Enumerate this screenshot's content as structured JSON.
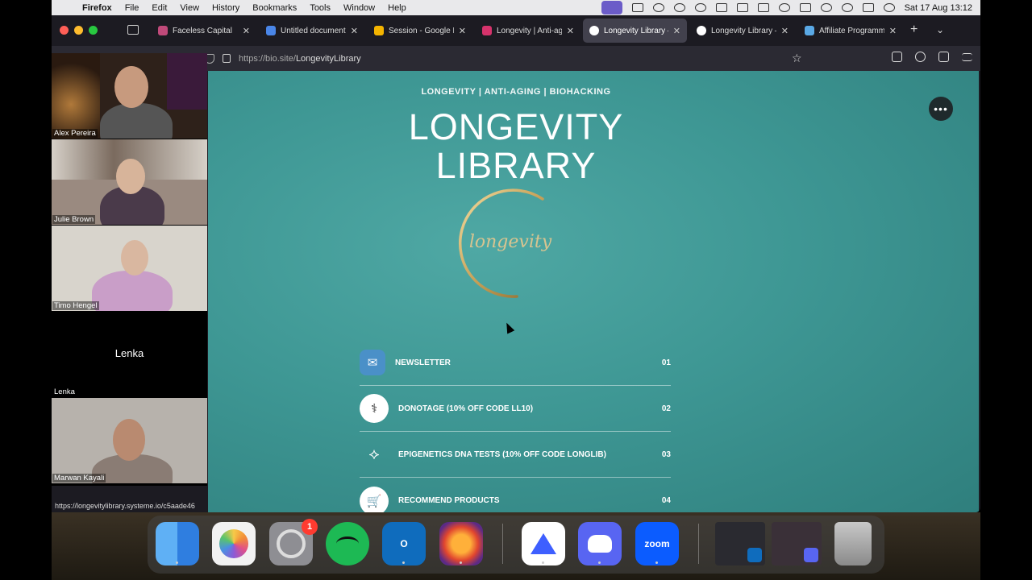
{
  "menubar": {
    "app": "Firefox",
    "items": [
      "File",
      "Edit",
      "View",
      "History",
      "Bookmarks",
      "Tools",
      "Window",
      "Help"
    ],
    "clock": "Sat 17 Aug  13:12"
  },
  "browser": {
    "tabs": [
      {
        "title": "Faceless Capital",
        "favicon_color": "#c04a7a"
      },
      {
        "title": "Untitled document -",
        "favicon_color": "#4a86e8"
      },
      {
        "title": "Session - Google Dr",
        "favicon_color": "#f4b400"
      },
      {
        "title": "Longevity | Anti-aging",
        "favicon_color": "#d6336c"
      },
      {
        "title": "Longevity Library —",
        "favicon_color": "#ffffff"
      },
      {
        "title": "Longevity Library —",
        "favicon_color": "#ffffff"
      },
      {
        "title": "Affiliate Programme",
        "favicon_color": "#5aa9e6"
      }
    ],
    "url_prefix": "https://bio.site/",
    "url_path": "LongevityLibrary",
    "status_url": "https://longevitylibrary.systeme.io/c5aade46"
  },
  "gallery": [
    {
      "name": "Alex Pereira",
      "bg": "#3a2a22"
    },
    {
      "name": "Julie Brown",
      "bg": "#9a8a80"
    },
    {
      "name": "Timo Hengel",
      "bg": "#d8d4cc"
    },
    {
      "name": "Lenka",
      "bg": "#000000",
      "center_label": "Lenka"
    },
    {
      "name": "Marwan Kayali",
      "bg": "#b7b2ac"
    }
  ],
  "page": {
    "eyebrow": "LONGEVITY | ANTI-AGING | BIOHACKING",
    "headline_line1": "LONGEVITY",
    "headline_line2": "LIBRARY",
    "logo_text": "longevity",
    "more_label": "•••",
    "links": [
      {
        "label": "NEWSLETTER",
        "num": "01",
        "icon": "newsletter-icon"
      },
      {
        "label": "DONOTAGE (10% OFF CODE LL10)",
        "num": "02",
        "icon": "dna-icon"
      },
      {
        "label": "EPIGENETICS DNA TESTS (10% OFF CODE LONGLIB)",
        "num": "03",
        "icon": "dna-strand-icon"
      },
      {
        "label": "RECOMMEND PRODUCTS",
        "num": "04",
        "icon": "cart-icon"
      }
    ]
  },
  "dock": {
    "items": [
      {
        "name": "Finder",
        "color": "#3c8ce7"
      },
      {
        "name": "Photos",
        "color": "#f2f2f2"
      },
      {
        "name": "System Settings",
        "color": "#8e8e93",
        "badge": "1"
      },
      {
        "name": "Spotify",
        "color": "#1db954"
      },
      {
        "name": "Outlook",
        "color": "#0f6cbd"
      },
      {
        "name": "Firefox",
        "color": "#5b2a86"
      },
      {
        "name": "NordVPN",
        "color": "#ffffff"
      },
      {
        "name": "Discord",
        "color": "#5865f2"
      },
      {
        "name": "zoom",
        "color": "#0b5cff"
      }
    ]
  }
}
